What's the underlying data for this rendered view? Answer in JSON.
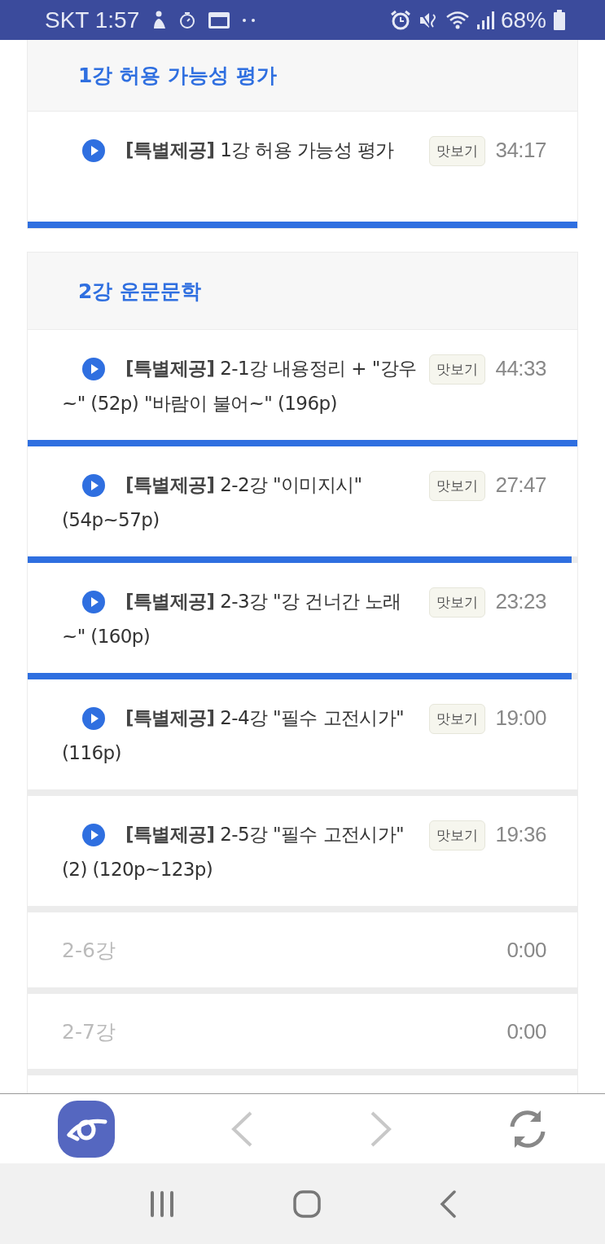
{
  "status_bar": {
    "carrier_time": "SKT 1:57",
    "battery": "68%"
  },
  "sections": [
    {
      "title": "1강 허용 가능성 평가",
      "lessons": [
        {
          "kind": "preview",
          "title": "**[특별제공]** 1강 허용 가능성 평가",
          "badge": "맛보기",
          "duration": "34:17",
          "level": 1
        }
      ]
    },
    {
      "title": "2강 운문문학",
      "lessons": [
        {
          "kind": "preview",
          "title": "**[특별제공]** 2-1강 내용정리 + \"강우~\" (52p) \"바람이 불어~\" (196p)",
          "badge": "맛보기",
          "duration": "44:33",
          "level": 1
        },
        {
          "kind": "preview",
          "title": "**[특별제공]** 2-2강 \"이미지시\" (54p~57p)",
          "badge": "맛보기",
          "duration": "27:47",
          "level": 0.99
        },
        {
          "kind": "preview",
          "title": "**[특별제공]** 2-3강 \"강 건너간 노래~\" (160p)",
          "badge": "맛보기",
          "duration": "23:23",
          "level": 0.99
        },
        {
          "kind": "preview",
          "title": "**[특별제공]** 2-4강 \"필수 고전시가\" (116p)",
          "badge": "맛보기",
          "duration": "19:00",
          "level": 0
        },
        {
          "kind": "preview",
          "title": "**[특별제공]** 2-5강 \"필수 고전시가\"(2) (120p~123p)",
          "badge": "맛보기",
          "duration": "19:36",
          "level": 0
        },
        {
          "kind": "locked",
          "title": "2-6강",
          "duration": "0:00",
          "level": 0
        },
        {
          "kind": "locked",
          "title": "2-7강",
          "duration": "0:00",
          "level": 0
        }
      ]
    }
  ]
}
